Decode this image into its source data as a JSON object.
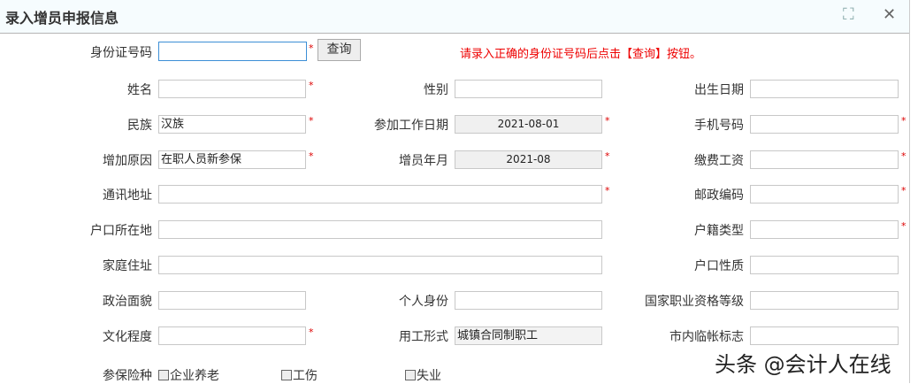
{
  "dialog": {
    "title": "录入增员申报信息",
    "close_icon": "close-icon",
    "zoom_icon": "select-zoom-icon"
  },
  "id_row": {
    "label": "身份证号码",
    "value": "",
    "query_button": "查询",
    "hint": "请录入正确的身份证号码后点击【查询】按钮。"
  },
  "fields": {
    "name": {
      "label": "姓名",
      "value": ""
    },
    "gender": {
      "label": "性别",
      "value": ""
    },
    "birth": {
      "label": "出生日期",
      "value": ""
    },
    "ethnicity": {
      "label": "民族",
      "value": "汉族"
    },
    "work_start": {
      "label": "参加工作日期",
      "value": "2021-08-01"
    },
    "mobile": {
      "label": "手机号码",
      "value": ""
    },
    "reason": {
      "label": "增加原因",
      "value": "在职人员新参保"
    },
    "add_month": {
      "label": "增员年月",
      "value": "2021-08"
    },
    "wage": {
      "label": "缴费工资",
      "value": ""
    },
    "address": {
      "label": "通讯地址",
      "value": ""
    },
    "postcode": {
      "label": "邮政编码",
      "value": ""
    },
    "hukou_place": {
      "label": "户口所在地",
      "value": ""
    },
    "hukou_type": {
      "label": "户籍类型",
      "value": ""
    },
    "home": {
      "label": "家庭住址",
      "value": ""
    },
    "hukou_nature": {
      "label": "户口性质",
      "value": ""
    },
    "political": {
      "label": "政治面貌",
      "value": ""
    },
    "identity": {
      "label": "个人身份",
      "value": ""
    },
    "qualification": {
      "label": "国家职业资格等级",
      "value": ""
    },
    "education": {
      "label": "文化程度",
      "value": ""
    },
    "employment": {
      "label": "用工形式",
      "value": "城镇合同制职工"
    },
    "temp_flag": {
      "label": "市内临帐标志",
      "value": ""
    }
  },
  "insurance": {
    "label": "参保险种",
    "options": [
      "企业养老",
      "工伤",
      "失业"
    ]
  },
  "watermark": "头条 @会计人在线",
  "star": "*"
}
